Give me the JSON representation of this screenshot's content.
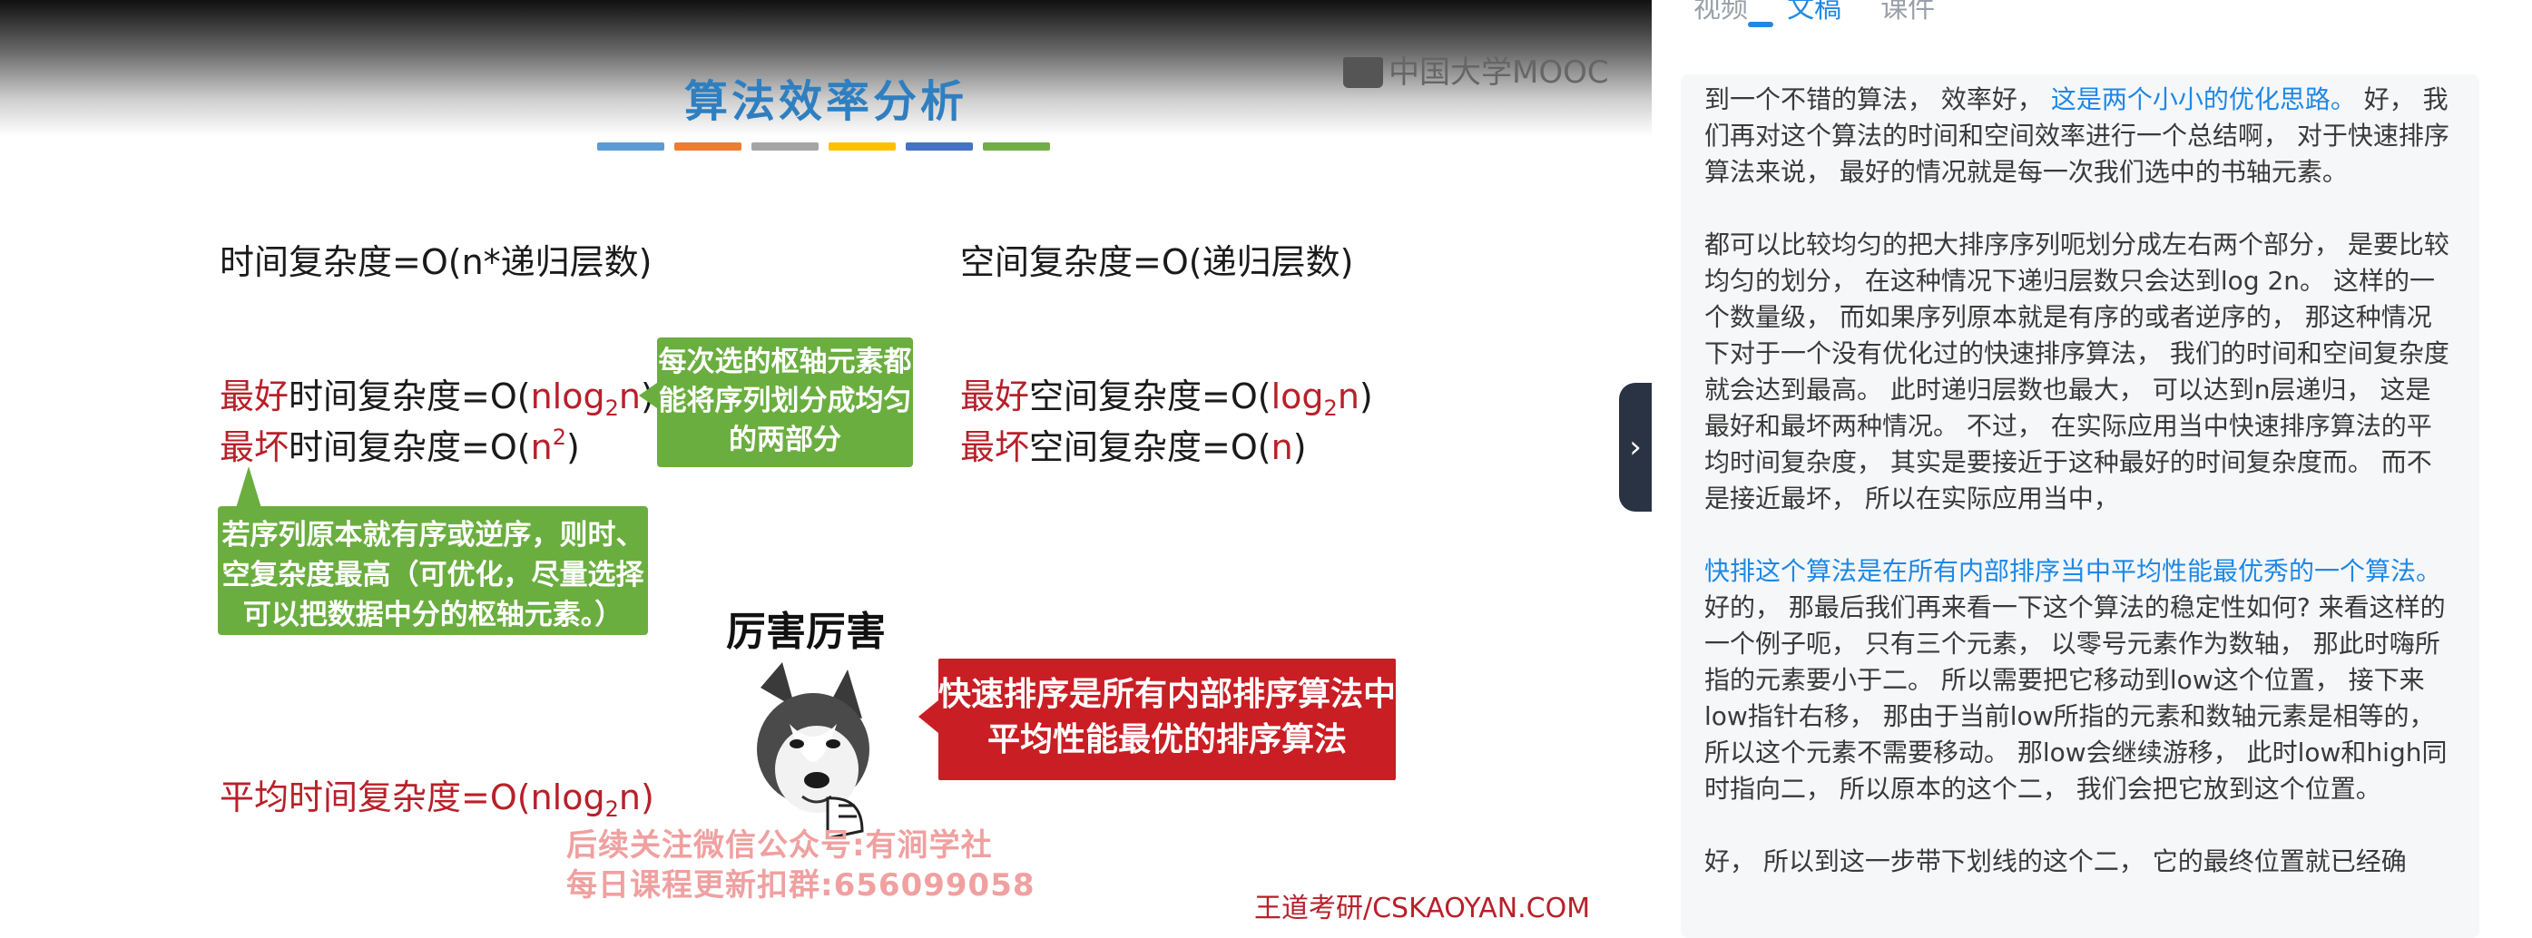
{
  "slide": {
    "title": "算法效率分析",
    "title_bar_colors": [
      "#5b9bd5",
      "#ed7d31",
      "#a5a5a5",
      "#ffc000",
      "#4472c4",
      "#70ad47"
    ],
    "logo": "中国大学MOOC",
    "time_complexity": "时间复杂度=O(n*递归层数)",
    "space_complexity": "空间复杂度=O(递归层数)",
    "best_time": {
      "prefix": "最好",
      "text": "时间复杂度=O(",
      "value": "nlog",
      "sub": "2",
      "value2": "n",
      "end": ")"
    },
    "worst_time": {
      "prefix": "最坏",
      "text": "时间复杂度=O(",
      "value": "n",
      "sup": "2",
      "end": ")"
    },
    "best_space": {
      "prefix": "最好",
      "text": "空间复杂度=O(",
      "value": "log",
      "sub": "2",
      "value2": "n",
      "end": ")"
    },
    "worst_space": {
      "prefix": "最坏",
      "text": "空间复杂度=O(",
      "value": "n",
      "end": ")"
    },
    "avg_time": {
      "text": "平均时间复杂度=O(",
      "value": "nlog",
      "sub": "2",
      "value2": "n",
      "end": ")"
    },
    "callout_pivot": [
      "每次选的枢轴元素都",
      "能将序列划分成均匀",
      "的两部分"
    ],
    "callout_worst": [
      "若序列原本就有序或逆序，则时、",
      "空复杂度最高（可优化，尽量选择",
      "可以把数据中分的枢轴元素。）"
    ],
    "meme_caption": "厉害厉害",
    "highlight_box": [
      "快速排序是所有内部排序算法中",
      "平均性能最优的排序算法"
    ],
    "watermark": [
      "后续关注微信公众号:有涧学社",
      "每日课程更新扣群:656099058"
    ],
    "footer_credit": "王道考研/CSKAOYAN.COM",
    "colors": {
      "accent_red": "#b8202a",
      "callout_green": "#6aae3f",
      "highlight_red": "#c81e24",
      "title_blue": "#2f7fc0"
    }
  },
  "collapse_handle": {
    "icon": "chevron-right-icon",
    "glyph": "›"
  },
  "tabs": [
    {
      "label": "视频",
      "active": false
    },
    {
      "label": "文稿",
      "active": true
    },
    {
      "label": "课件",
      "active": false
    }
  ],
  "transcript": {
    "p1": {
      "a": "到一个不错的算法， 效率好， ",
      "b": "这是两个小小的优化思路。",
      "c": " 好， 我们再对这个算法的时间和空间效率进行一个总结啊， 对于快速排序算法来说， 最好的情况就是每一次我们选中的书轴元素。"
    },
    "p2": "都可以比较均匀的把大排序序列呃划分成左右两个部分， 是要比较均匀的划分， 在这种情况下递归层数只会达到log 2n。 这样的一个数量级， 而如果序列原本就是有序的或者逆序的， 那这种情况下对于一个没有优化过的快速排序算法， 我们的时间和空间复杂度就会达到最高。 此时递归层数也最大， 可以达到n层递归， 这是最好和最坏两种情况。 不过， 在实际应用当中快速排序算法的平均时间复杂度， 其实是要接近于这种最好的时间复杂度而。 而不是接近最坏， 所以在实际应用当中，",
    "p3": {
      "a": "快排这个算法是在所有内部排序当中平均性能最优秀的一个算法。",
      "b": " 好的， 那最后我们再来看一下这个算法的稳定性如何? 来看这样的一个例子呃， 只有三个元素， 以零号元素作为数轴， 那此时嗨所指的元素要小于二。 所以需要把它移动到low这个位置， 接下来low指针右移， 那由于当前low所指的元素和数轴元素是相等的， 所以这个元素不需要移动。 那low会继续游移， 此时low和high同时指向二， 所以原本的这个二， 我们会把它放到这个位置。"
    },
    "p4": "好， 所以到这一步带下划线的这个二， 它的最终位置就已经确"
  }
}
